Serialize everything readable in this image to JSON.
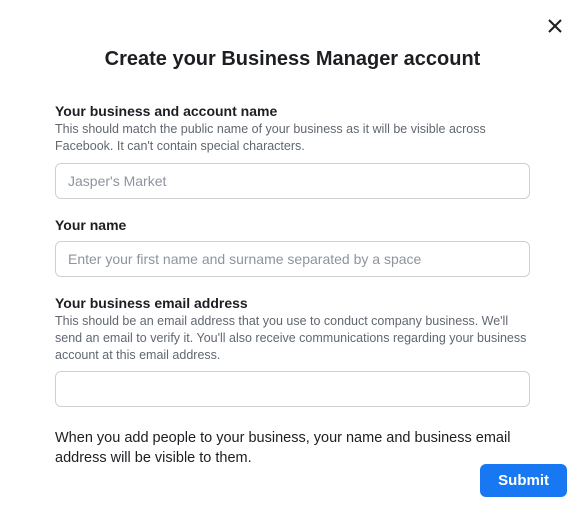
{
  "dialog": {
    "title": "Create your Business Manager account"
  },
  "fields": {
    "business_name": {
      "label": "Your business and account name",
      "help": "This should match the public name of your business as it will be visible across Facebook. It can't contain special characters.",
      "placeholder": "Jasper's Market",
      "value": ""
    },
    "your_name": {
      "label": "Your name",
      "placeholder": "Enter your first name and surname separated by a space",
      "value": ""
    },
    "business_email": {
      "label": "Your business email address",
      "help": "This should be an email address that you use to conduct company business. We'll send an email to verify it. You'll also receive communications regarding your business account at this email address.",
      "placeholder": "",
      "value": ""
    }
  },
  "note": "When you add people to your business, your name and business email address will be visible to them.",
  "actions": {
    "submit_label": "Submit"
  }
}
